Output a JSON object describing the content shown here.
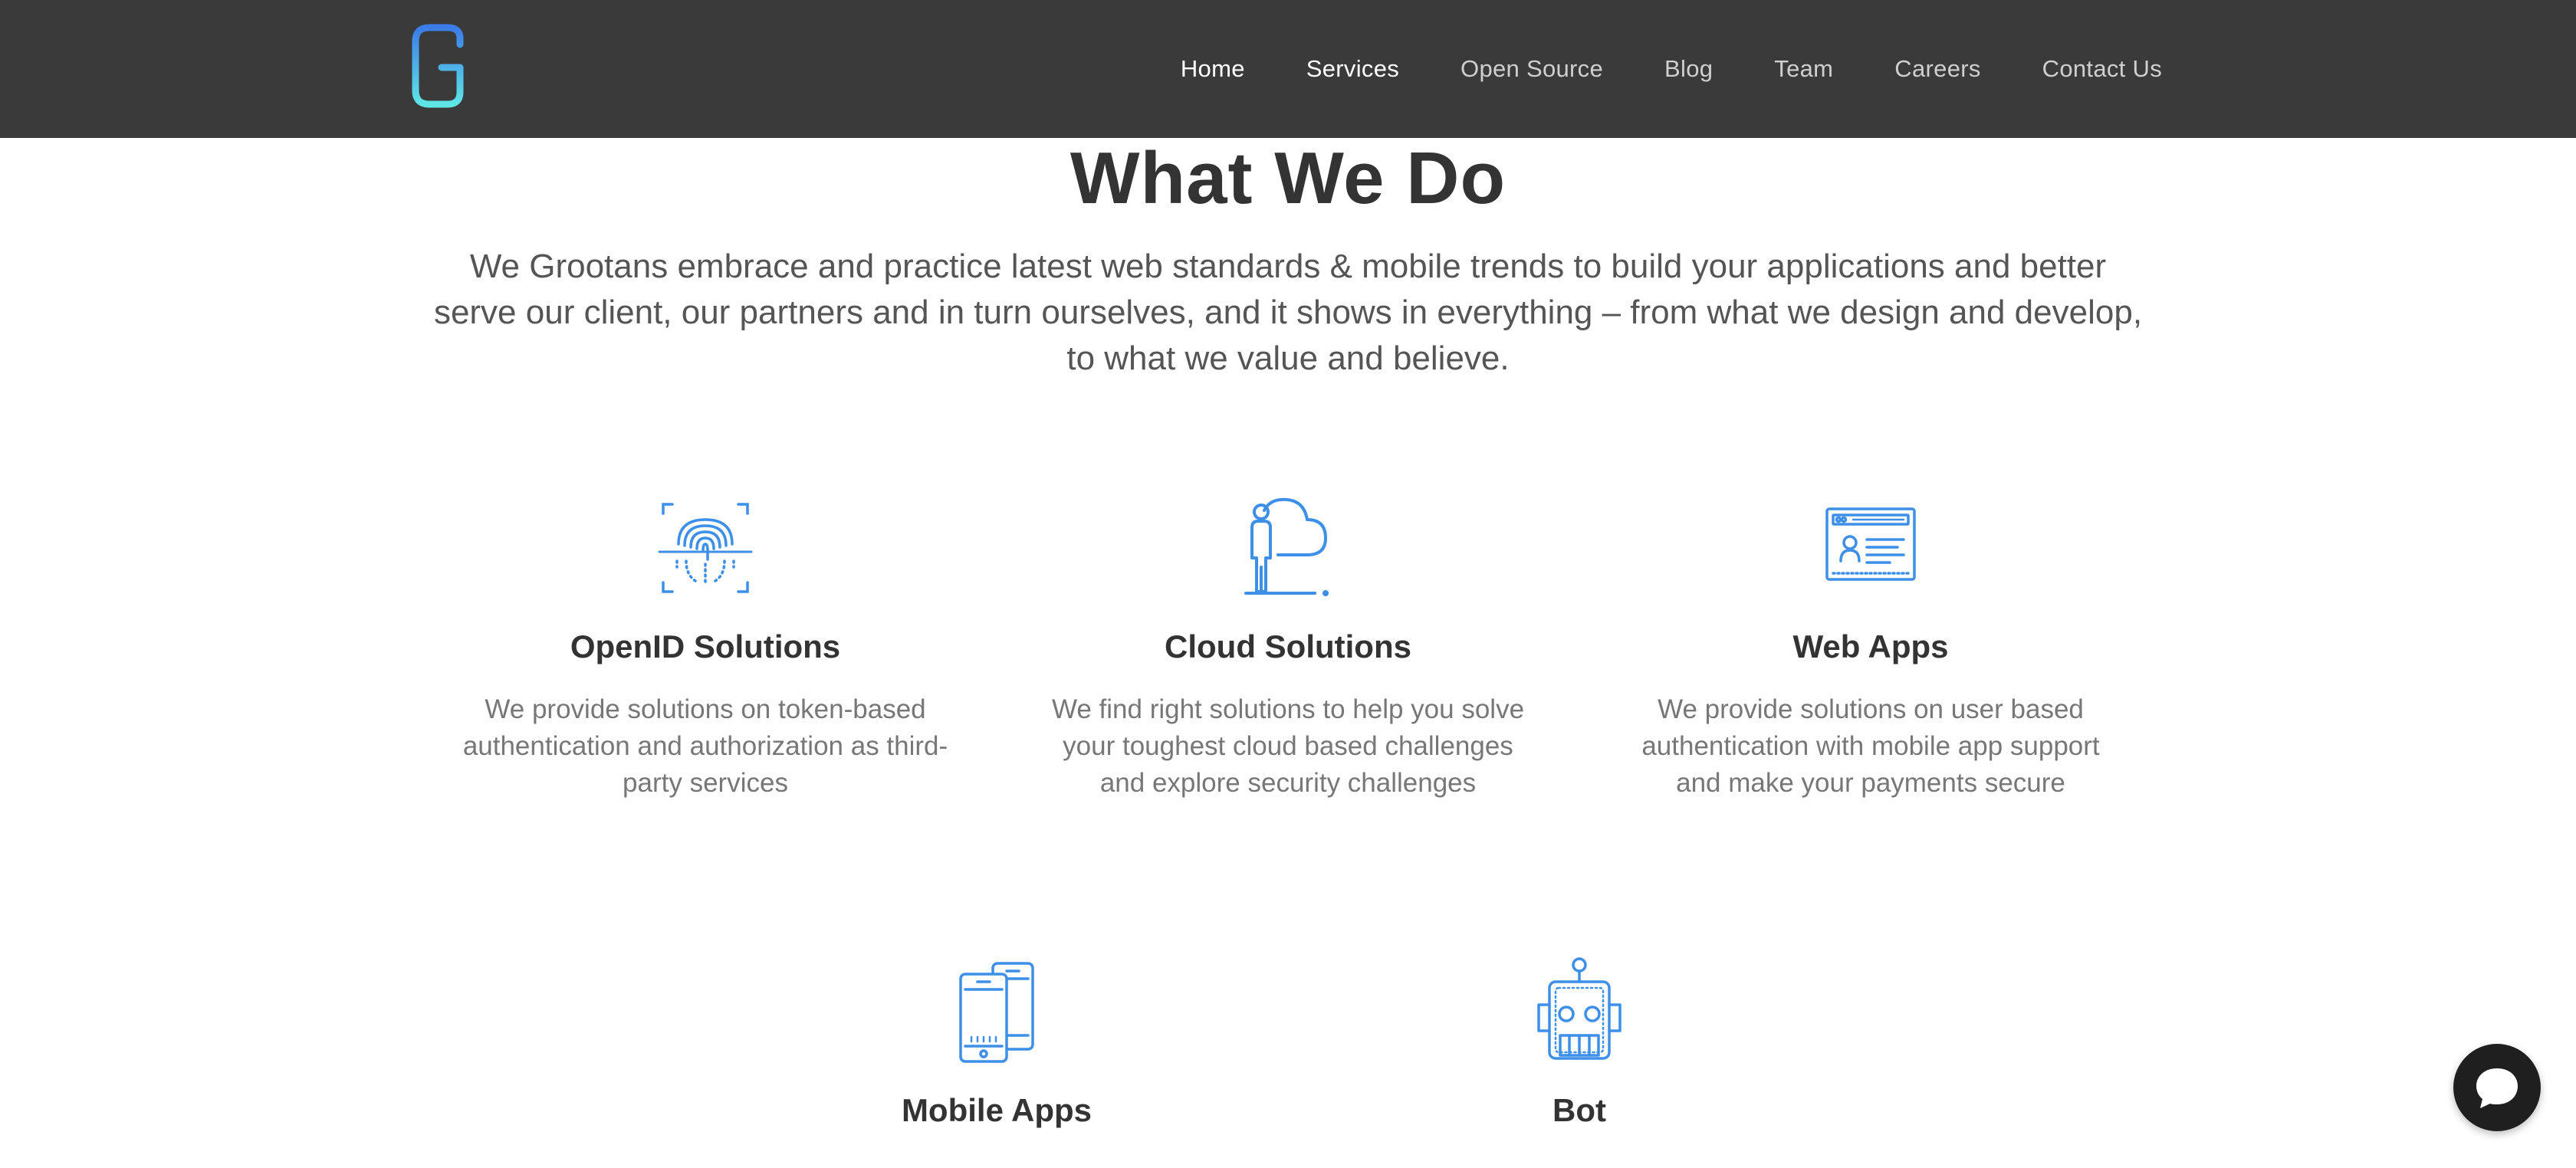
{
  "header": {
    "logo_letter": "G",
    "nav": [
      {
        "label": "Home",
        "active": true
      },
      {
        "label": "Services",
        "active": true
      },
      {
        "label": "Open Source",
        "active": false
      },
      {
        "label": "Blog",
        "active": false
      },
      {
        "label": "Team",
        "active": false
      },
      {
        "label": "Careers",
        "active": false
      },
      {
        "label": "Contact Us",
        "active": false
      }
    ]
  },
  "main": {
    "title": "What We Do",
    "intro": "We Grootans embrace and practice latest web standards & mobile trends to build your applications and better serve our client, our partners and in turn ourselves, and it shows in everything – from what we design and develop, to what we value and believe.",
    "services": [
      {
        "icon": "fingerprint-icon",
        "title": "OpenID Solutions",
        "description": "We provide solutions on token-based authentication and authorization as third-party services"
      },
      {
        "icon": "cloud-person-icon",
        "title": "Cloud Solutions",
        "description": "We find right solutions to help you solve your toughest cloud based challenges and explore security challenges"
      },
      {
        "icon": "web-app-icon",
        "title": "Web Apps",
        "description": "We provide solutions on user based authentication with mobile app support and make your payments secure"
      },
      {
        "icon": "mobile-phones-icon",
        "title": "Mobile Apps",
        "description": ""
      },
      {
        "icon": "robot-icon",
        "title": "Bot",
        "description": ""
      }
    ]
  },
  "colors": {
    "header_bg": "#3a3a3a",
    "accent_blue": "#3d8fe8",
    "logo_gradient_top": "#3b7be8",
    "logo_gradient_bottom": "#5ee6e6",
    "title_text": "#333333",
    "body_text": "#777777"
  },
  "chat": {
    "icon": "chat-bubble-icon"
  }
}
